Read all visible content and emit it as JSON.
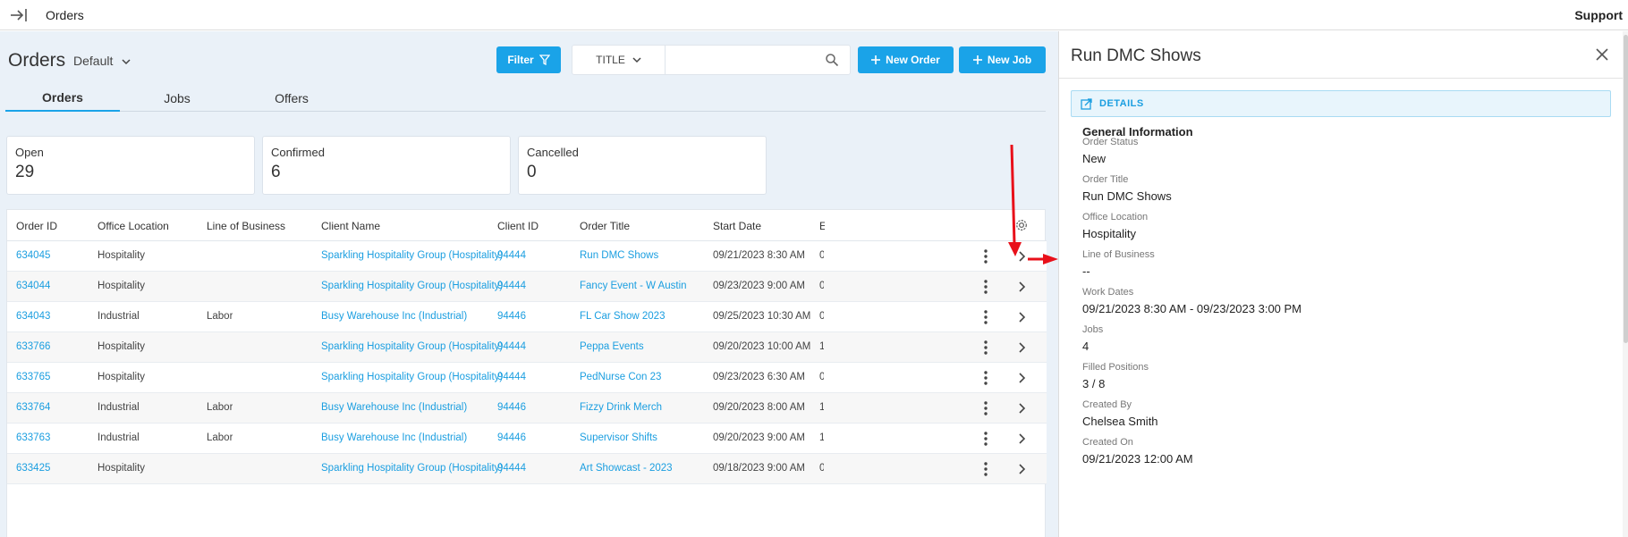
{
  "topbar": {
    "title": "Orders",
    "support": "Support"
  },
  "header": {
    "page_title": "Orders",
    "view": "Default",
    "filter_label": "Filter",
    "search_field": "TITLE",
    "search_placeholder": "",
    "new_order_label": "New Order",
    "new_job_label": "New Job"
  },
  "tabs": [
    {
      "label": "Orders"
    },
    {
      "label": "Jobs"
    },
    {
      "label": "Offers"
    }
  ],
  "stats": [
    {
      "label": "Open",
      "value": "29"
    },
    {
      "label": "Confirmed",
      "value": "6"
    },
    {
      "label": "Cancelled",
      "value": "0"
    }
  ],
  "table": {
    "columns": [
      "Order ID",
      "Office Location",
      "Line of Business",
      "Client Name",
      "Client ID",
      "Order Title",
      "Start Date",
      "E"
    ],
    "rows": [
      {
        "order_id": "634045",
        "office": "Hospitality",
        "lob": "",
        "client": "Sparkling Hospitality Group (Hospitality)",
        "client_id": "94444",
        "title": "Run DMC Shows",
        "start": "09/21/2023 8:30 AM",
        "e": "0"
      },
      {
        "order_id": "634044",
        "office": "Hospitality",
        "lob": "",
        "client": "Sparkling Hospitality Group (Hospitality)",
        "client_id": "94444",
        "title": "Fancy Event - W Austin",
        "start": "09/23/2023 9:00 AM",
        "e": "0"
      },
      {
        "order_id": "634043",
        "office": "Industrial",
        "lob": "Labor",
        "client": "Busy Warehouse Inc (Industrial)",
        "client_id": "94446",
        "title": "FL Car Show 2023",
        "start": "09/25/2023 10:30 AM",
        "e": "0"
      },
      {
        "order_id": "633766",
        "office": "Hospitality",
        "lob": "",
        "client": "Sparkling Hospitality Group (Hospitality)",
        "client_id": "94444",
        "title": "Peppa Events",
        "start": "09/20/2023 10:00 AM",
        "e": "1"
      },
      {
        "order_id": "633765",
        "office": "Hospitality",
        "lob": "",
        "client": "Sparkling Hospitality Group (Hospitality)",
        "client_id": "94444",
        "title": "PedNurse Con 23",
        "start": "09/23/2023 6:30 AM",
        "e": "0"
      },
      {
        "order_id": "633764",
        "office": "Industrial",
        "lob": "Labor",
        "client": "Busy Warehouse Inc (Industrial)",
        "client_id": "94446",
        "title": "Fizzy Drink Merch",
        "start": "09/20/2023 8:00 AM",
        "e": "1"
      },
      {
        "order_id": "633763",
        "office": "Industrial",
        "lob": "Labor",
        "client": "Busy Warehouse Inc (Industrial)",
        "client_id": "94446",
        "title": "Supervisor Shifts",
        "start": "09/20/2023 9:00 AM",
        "e": "1"
      },
      {
        "order_id": "633425",
        "office": "Hospitality",
        "lob": "",
        "client": "Sparkling Hospitality Group (Hospitality)",
        "client_id": "94444",
        "title": "Art Showcast - 2023",
        "start": "09/18/2023 9:00 AM",
        "e": "0"
      }
    ]
  },
  "panel": {
    "title": "Run DMC Shows",
    "details_label": "DETAILS",
    "section_title": "General Information",
    "fields": [
      {
        "label": "Order Status",
        "value": "New"
      },
      {
        "label": "Order Title",
        "value": "Run DMC Shows"
      },
      {
        "label": "Office Location",
        "value": "Hospitality"
      },
      {
        "label": "Line of Business",
        "value": "--"
      },
      {
        "label": "Work Dates",
        "value": "09/21/2023 8:30 AM - 09/23/2023 3:00 PM"
      },
      {
        "label": "Jobs",
        "value": "4"
      },
      {
        "label": "Filled Positions",
        "value": "3 / 8"
      },
      {
        "label": "Created By",
        "value": "Chelsea Smith"
      },
      {
        "label": "Created On",
        "value": "09/21/2023 12:00 AM"
      }
    ]
  },
  "colors": {
    "accent": "#1aa3e8",
    "link": "#1a9ee0",
    "annotation": "#e8101a"
  }
}
